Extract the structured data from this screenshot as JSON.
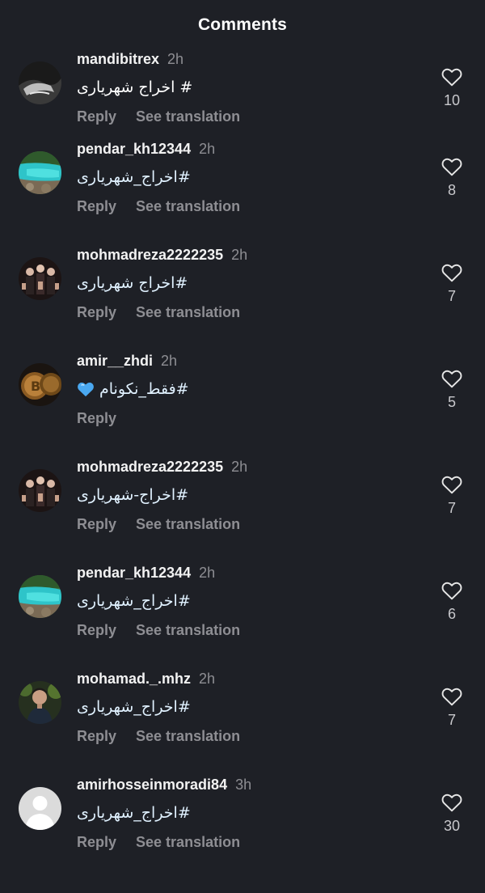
{
  "header": {
    "title": "Comments"
  },
  "colors": {
    "background": "#1e2026",
    "hashtag": "#e0f1ff",
    "secondary_text": "#8e8e93"
  },
  "comments": [
    {
      "username": "mandibitrex",
      "time": "2h",
      "text": "# اخراج شهریاری",
      "reply": "Reply",
      "translate": "See translation",
      "likes": "10",
      "avatar": "dark-hand-avatar"
    },
    {
      "username": "pendar_kh12344",
      "time": "2h",
      "text": "#اخراج_شهریاری",
      "reply": "Reply",
      "translate": "See translation",
      "likes": "8",
      "avatar": "turquoise-lake-avatar"
    },
    {
      "username": "mohmadreza2222235",
      "time": "2h",
      "text": "#اخراج شهریاری",
      "reply": "Reply",
      "translate": "See translation",
      "likes": "7",
      "avatar": "group-photo-avatar"
    },
    {
      "username": "amir__zhdi",
      "time": "2h",
      "text": "#فقط_نکونام",
      "emoji": "blue-heart-emoji",
      "reply": "Reply",
      "translate": "",
      "likes": "5",
      "avatar": "bitcoin-coins-avatar"
    },
    {
      "username": "mohmadreza2222235",
      "time": "2h",
      "text": "#اخراج-شهریاری",
      "reply": "Reply",
      "translate": "See translation",
      "likes": "7",
      "avatar": "group-photo-avatar"
    },
    {
      "username": "pendar_kh12344",
      "time": "2h",
      "text": "#اخراج_شهریاری",
      "reply": "Reply",
      "translate": "See translation",
      "likes": "6",
      "avatar": "turquoise-lake-avatar"
    },
    {
      "username": "mohamad._.mhz",
      "time": "2h",
      "text": "#اخراج_شهریاری",
      "reply": "Reply",
      "translate": "See translation",
      "likes": "7",
      "avatar": "man-portrait-avatar"
    },
    {
      "username": "amirhosseinmoradi84",
      "time": "3h",
      "text": "#اخراج_شهریاری",
      "reply": "Reply",
      "translate": "See translation",
      "likes": "30",
      "avatar": "default-avatar"
    }
  ]
}
